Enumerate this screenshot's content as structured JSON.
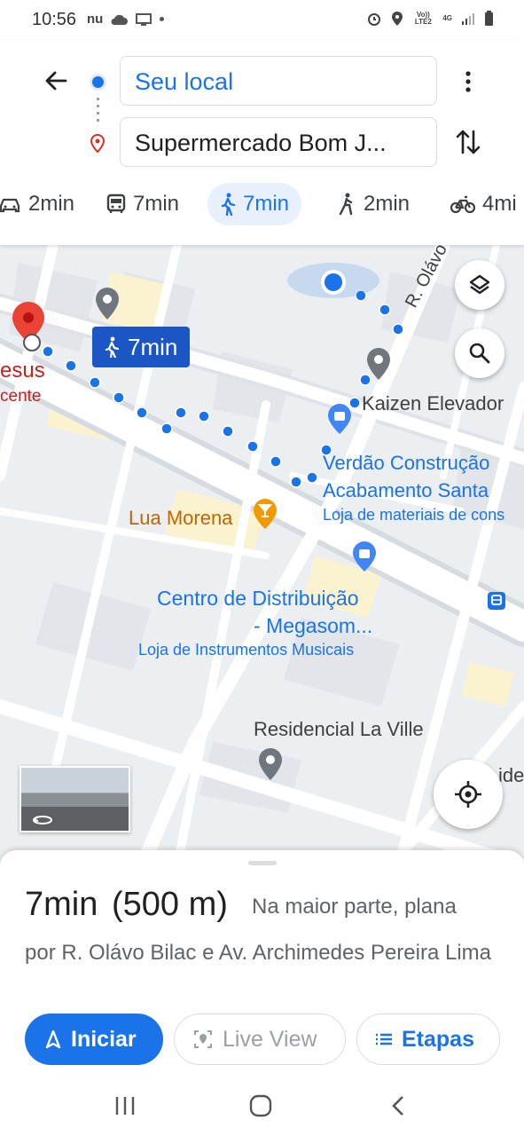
{
  "status": {
    "time": "10:56",
    "nu": "nu",
    "volte": "Vo)) LTE2",
    "net": "4G"
  },
  "search": {
    "origin": "Seu local",
    "destination": "Supermercado Bom J..."
  },
  "modes": [
    {
      "label": "2min",
      "icon": "car-icon"
    },
    {
      "label": "7min",
      "icon": "bus-icon"
    },
    {
      "label": "7min",
      "icon": "walk-icon",
      "selected": true
    },
    {
      "label": "2min",
      "icon": "ride-icon"
    },
    {
      "label": "4mi",
      "icon": "bike-icon"
    }
  ],
  "map": {
    "badge": "7min",
    "street": "R. Olávo",
    "labels": {
      "dest_a": "esus",
      "dest_b": "cente",
      "kaizen": "Kaizen Elevador",
      "verdao1": "Verdão Construção",
      "verdao2": "Acabamento Santa",
      "verdao3": "Loja de materiais de cons",
      "lua": "Lua Morena",
      "centro1": "Centro de Distribuição",
      "centro2": "- Megasom...",
      "centro3": "Loja de Instrumentos Musicais",
      "residencial": "Residencial La Ville",
      "ide": "ide"
    }
  },
  "route": {
    "duration": "7min",
    "distance": "(500 m)",
    "terrain": "Na maior parte, plana",
    "via": "por R. Olávo Bilac e Av. Archimedes Pereira Lima"
  },
  "actions": {
    "start": "Iniciar",
    "live": "Live View",
    "steps": "Etapas"
  },
  "colors": {
    "accent": "#1a73e8",
    "pin": "#ea4335",
    "poi_blue": "#1a73e8",
    "poi_orange": "#e37400"
  }
}
